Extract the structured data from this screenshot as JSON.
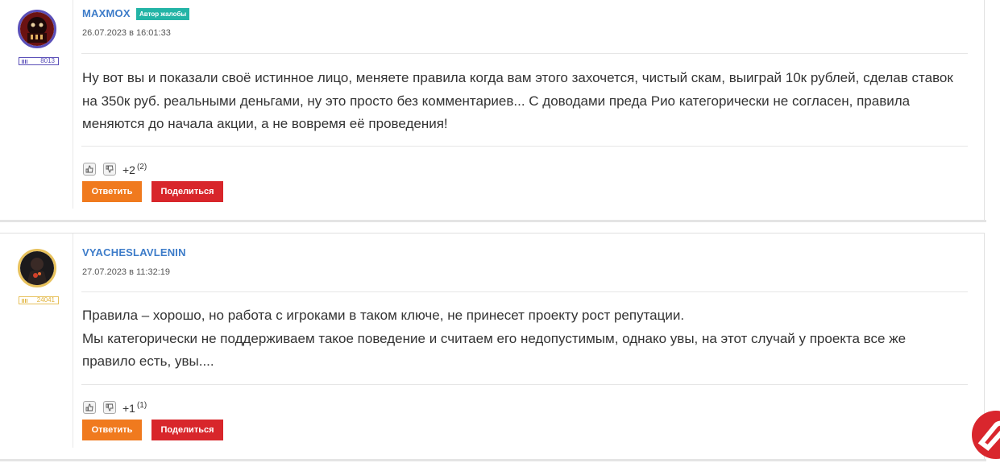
{
  "posts": [
    {
      "author": "MAXMOX",
      "badge": "Автор жалобы",
      "date": "26.07.2023 в 16:01:33",
      "reputation": "8013",
      "text": "Ну вот вы и показали своё истинное лицо, меняете правила когда вам этого захочется, чистый скам, выиграй 10к рублей, сделав ставок на 350к руб. реальными деньгами, ну это просто без комментариев... С доводами преда Рио категорически не согласен, правила меняются до начала акции, а не вовремя её проведения!",
      "score": "+2",
      "votes": "(2)",
      "reply_label": "Ответить",
      "share_label": "Поделиться",
      "avatar_border": "#5a4fb8"
    },
    {
      "author": "VYACHESLAVLENIN",
      "date": "27.07.2023 в 11:32:19",
      "reputation": "24041",
      "text_line1": "Правила – хорошо, но работа с игроками в таком ключе, не принесет проекту рост репутации.",
      "text_line2": "Мы категорически не поддерживаем такое поведение и считаем его недопустимым, однако увы, на этот случай у проекта все же правило есть, увы....",
      "score": "+1",
      "votes": "(1)",
      "reply_label": "Ответить",
      "share_label": "Поделиться",
      "avatar_border": "#e7c15c"
    }
  ],
  "colors": {
    "author": "#3d7cc9",
    "badge": "#23b4a6",
    "reply": "#f07a1e",
    "share": "#d8262b"
  }
}
